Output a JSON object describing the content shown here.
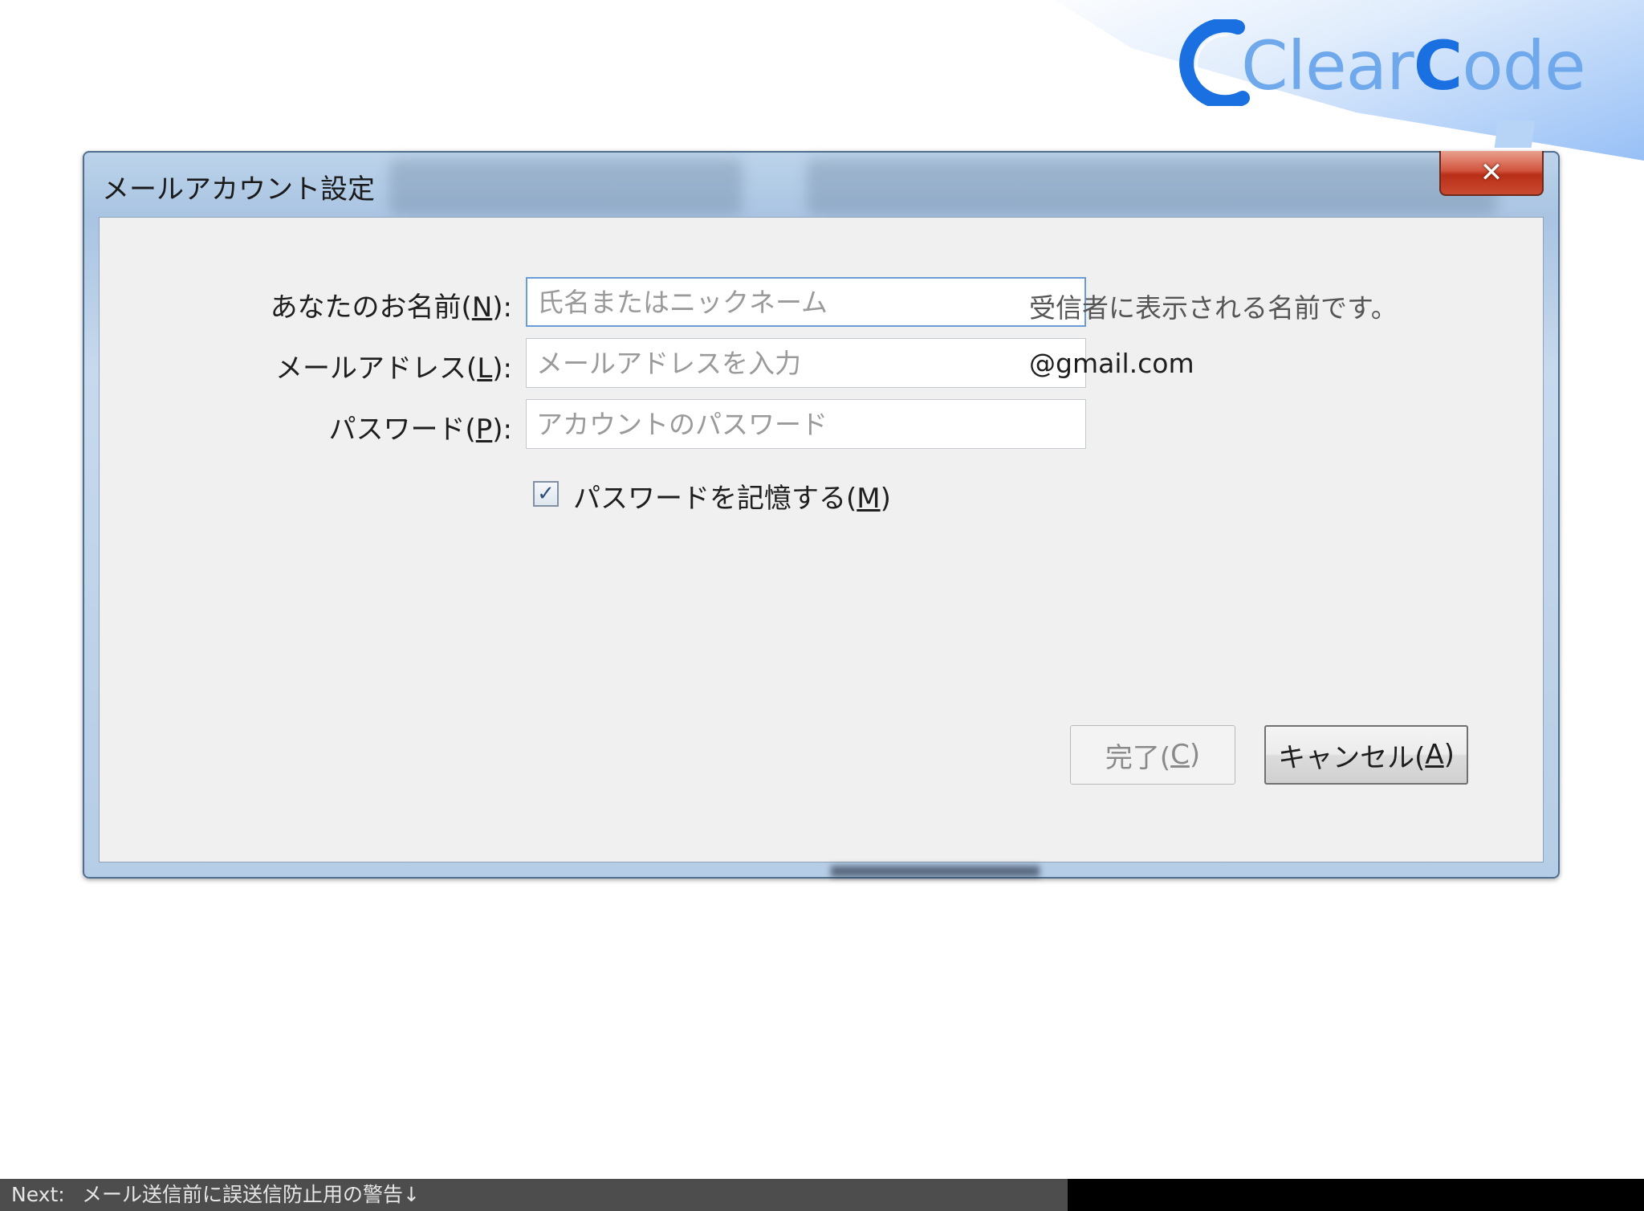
{
  "brand": {
    "logo_text_a": "Clear",
    "logo_text_b": "C",
    "logo_text_c": "ode",
    "color_primary": "#1a70e0",
    "color_light": "#6fa9ec"
  },
  "window": {
    "title": "メールアカウント設定",
    "close_icon": "close-icon"
  },
  "form": {
    "name_label": "あなたのお名前(",
    "name_key": "N",
    "name_label_end": "):",
    "name_placeholder": "氏名またはニックネーム",
    "name_hint": "受信者に表示される名前です。",
    "email_label": "メールアドレス(",
    "email_key": "L",
    "email_label_end": "):",
    "email_placeholder": "メールアドレスを入力",
    "email_domain": "@gmail.com",
    "password_label": "パスワード(",
    "password_key": "P",
    "password_label_end": "):",
    "password_placeholder": "アカウントのパスワード",
    "remember_label": "パスワードを記憶する(",
    "remember_key": "M",
    "remember_label_end": ")",
    "remember_checked": true
  },
  "buttons": {
    "done_label": "完了(",
    "done_key": "C",
    "done_end": ")",
    "cancel_label": "キャンセル(",
    "cancel_key": "A",
    "cancel_end": ")"
  },
  "footer": {
    "next_key": "Next:",
    "next_value": "メール送信前に誤送信防止用の警告↓"
  }
}
